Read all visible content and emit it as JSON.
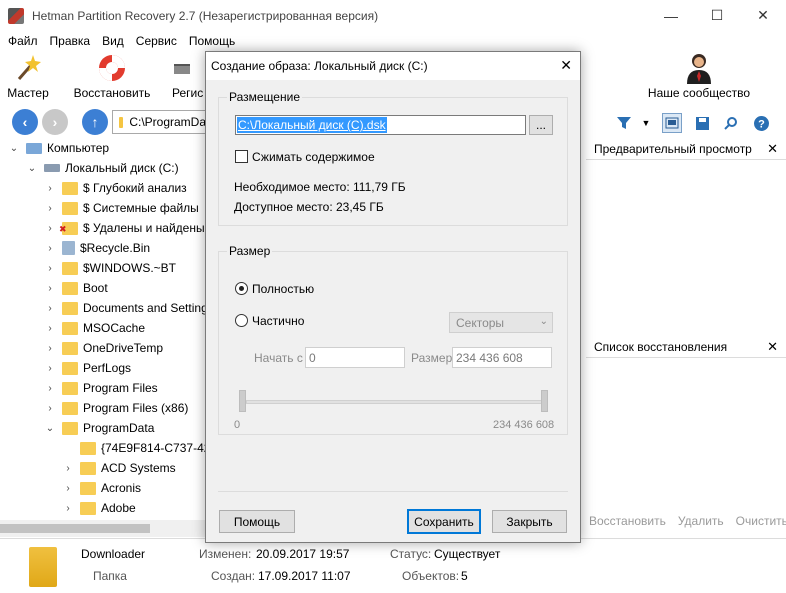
{
  "window": {
    "title": "Hetman Partition Recovery 2.7 (Незарегистрированная версия)",
    "min": "—",
    "max": "☐",
    "close": "✕"
  },
  "menu": [
    "Файл",
    "Правка",
    "Вид",
    "Сервис",
    "Помощь"
  ],
  "toolbar": {
    "wizard": "Мастер",
    "restore": "Восстановить",
    "register": "Регис",
    "community": "Наше сообщество"
  },
  "address": {
    "path": "C:\\ProgramDa"
  },
  "tree": [
    {
      "label": "Компьютер",
      "kind": "comp"
    },
    {
      "label": "Локальный диск (C:)",
      "kind": "disk"
    },
    {
      "label": "$ Глубокий анализ",
      "kind": "folder"
    },
    {
      "label": "$ Системные файлы",
      "kind": "folder"
    },
    {
      "label": "$ Удалены и найдены",
      "kind": "del"
    },
    {
      "label": "$Recycle.Bin",
      "kind": "bin"
    },
    {
      "label": "$WINDOWS.~BT",
      "kind": "folder"
    },
    {
      "label": "Boot",
      "kind": "folder"
    },
    {
      "label": "Documents and Setting",
      "kind": "folder"
    },
    {
      "label": "MSOCache",
      "kind": "folder"
    },
    {
      "label": "OneDriveTemp",
      "kind": "folder"
    },
    {
      "label": "PerfLogs",
      "kind": "folder"
    },
    {
      "label": "Program Files",
      "kind": "folder"
    },
    {
      "label": "Program Files (x86)",
      "kind": "folder"
    },
    {
      "label": "ProgramData",
      "kind": "folder"
    },
    {
      "label": "{74E9F814-C737-42C",
      "kind": "folder"
    },
    {
      "label": "ACD Systems",
      "kind": "folder"
    },
    {
      "label": "Acronis",
      "kind": "folder"
    },
    {
      "label": "Adobe",
      "kind": "folder"
    }
  ],
  "panes": {
    "preview": "Предварительный просмотр",
    "recovery_list": "Список восстановления",
    "close": "✕",
    "actions": [
      "Восстановить",
      "Удалить",
      "Очистить"
    ]
  },
  "status": {
    "name": "Downloader",
    "type": "Папка",
    "modified_label": "Изменен:",
    "modified": "20.09.2017 19:57",
    "created_label": "Создан:",
    "created": "17.09.2017 11:07",
    "state_label": "Статус:",
    "state": "Существует",
    "objects_label": "Объектов:",
    "objects": "5"
  },
  "dialog": {
    "title": "Создание образа: Локальный диск (C:)",
    "close": "✕",
    "placement_group": "Размещение",
    "path_value": "C:\\Локальный диск (C).dsk",
    "browse": "...",
    "compress": "Сжимать содержимое",
    "required_space": "Необходимое место: 111,79 ГБ",
    "available_space": "Доступное место: 23,45 ГБ",
    "size_group": "Размер",
    "full": "Полностью",
    "partial": "Частично",
    "unit": "Секторы",
    "start_label": "Начать с",
    "start_value": "0",
    "size_label": "Размер",
    "size_value": "234 436 608",
    "range_min": "0",
    "range_max": "234 436 608",
    "help_button": "Помощь",
    "save_button": "Сохранить",
    "close_button": "Закрыть"
  }
}
